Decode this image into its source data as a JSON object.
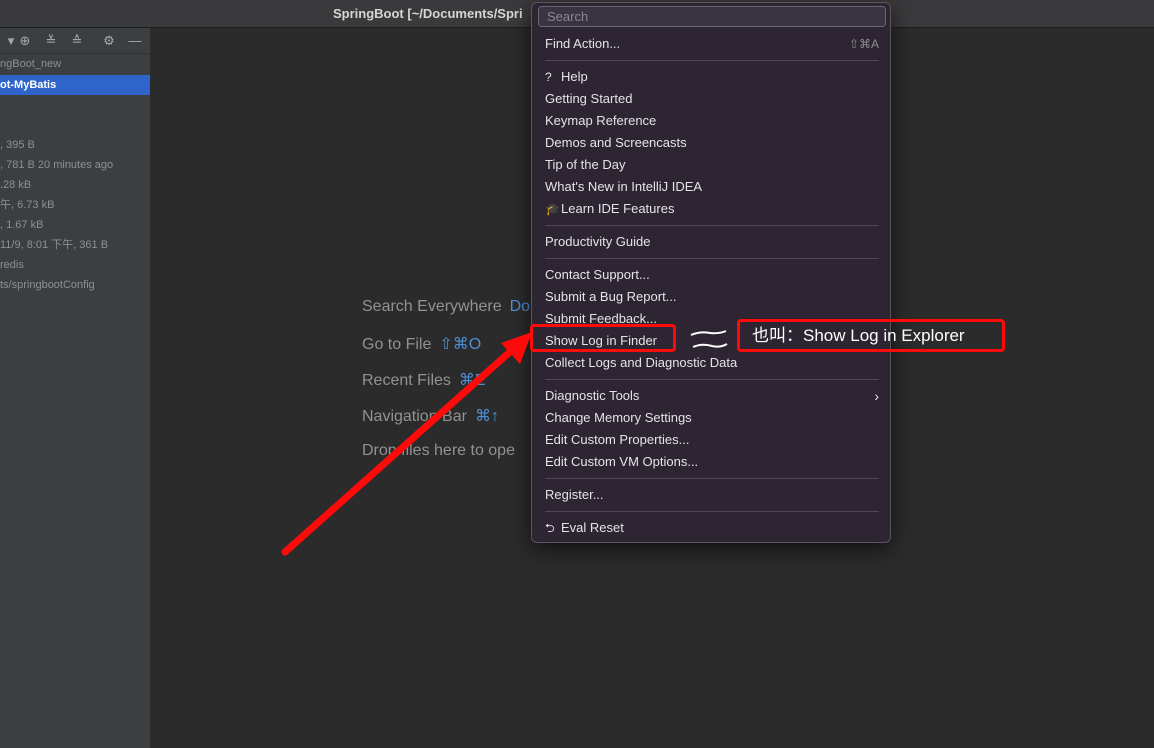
{
  "window": {
    "title": "SpringBoot [~/Documents/Spri"
  },
  "sidebar": {
    "rows": [
      "ngBoot_new",
      "ot-MyBatis",
      ", 395 B",
      ", 781 B 20 minutes ago",
      ".28 kB",
      "午, 6.73 kB",
      ", 1.67 kB",
      "11/9, 8:01 下午, 361 B",
      "redis",
      "ts/springbootConfig"
    ]
  },
  "welcome": {
    "hints": [
      {
        "label": "Search Everywhere",
        "key": "Do"
      },
      {
        "label": "Go to File",
        "key": "⇧⌘O"
      },
      {
        "label": "Recent Files",
        "key": "⌘E"
      },
      {
        "label": "Navigation Bar",
        "key": "⌘↑"
      },
      {
        "label": "Drop files here to ope",
        "key": ""
      }
    ]
  },
  "menu": {
    "search_placeholder": "Search",
    "find_action": {
      "label": "Find Action...",
      "shortcut": "⇧⌘A"
    },
    "help": "Help",
    "getting_started": "Getting Started",
    "keymap_reference": "Keymap Reference",
    "demos": "Demos and Screencasts",
    "tip": "Tip of the Day",
    "whats_new": "What's New in IntelliJ IDEA",
    "learn": "Learn IDE Features",
    "productivity": "Productivity Guide",
    "contact": "Contact Support...",
    "bug": "Submit a Bug Report...",
    "feedback": "Submit Feedback...",
    "show_log": "Show Log in Finder",
    "collect_logs": "Collect Logs and Diagnostic Data",
    "diagnostic": "Diagnostic Tools",
    "memory": "Change Memory Settings",
    "custom_props": "Edit Custom Properties...",
    "custom_vm": "Edit Custom VM Options...",
    "register": "Register...",
    "eval_reset": "Eval Reset"
  },
  "annotation": {
    "text": "也叫：Show  Log  in  Explorer"
  },
  "colors": {
    "highlight": "#ff0a0a",
    "selection": "#2f65ca",
    "link": "#4e8fd6"
  }
}
